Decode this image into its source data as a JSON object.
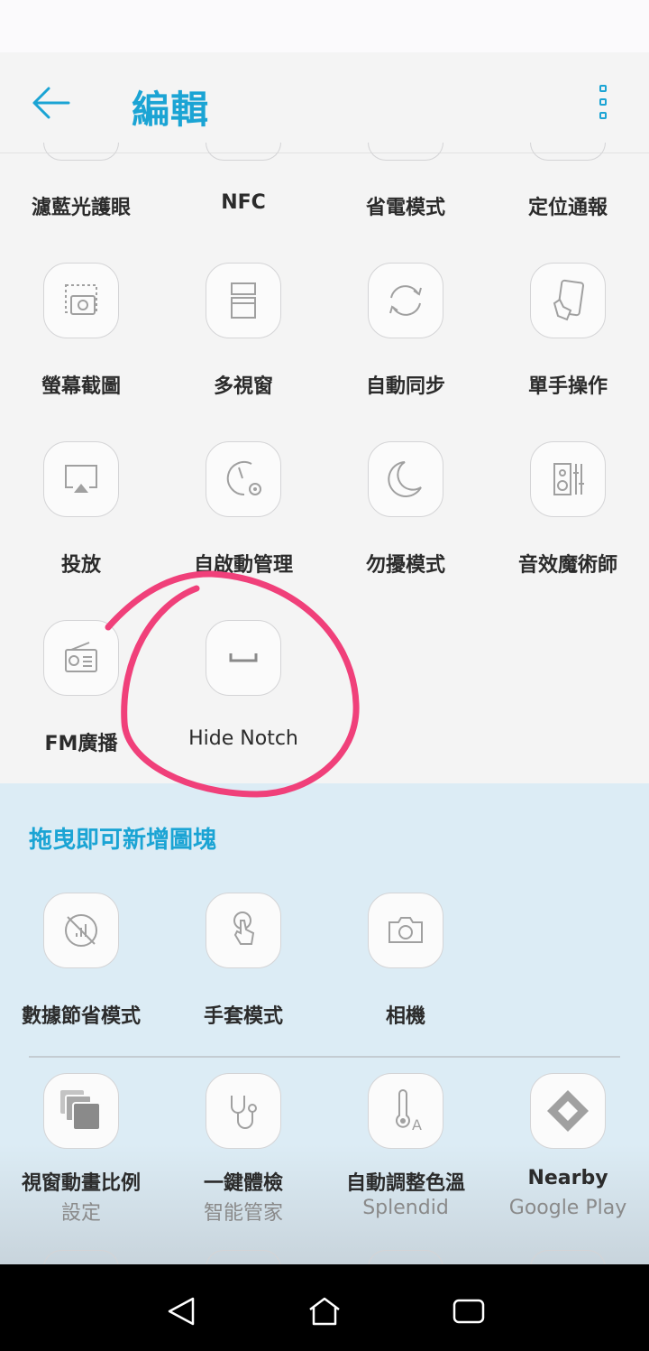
{
  "header": {
    "title": "編輯"
  },
  "active_tiles": [
    {
      "label": "濾藍光護眼",
      "icon": "bluelight-icon"
    },
    {
      "label": "NFC",
      "icon": "nfc-icon"
    },
    {
      "label": "省電模式",
      "icon": "battery-saver-icon"
    },
    {
      "label": "定位通報",
      "icon": "location-icon"
    },
    {
      "label": "螢幕截圖",
      "icon": "screenshot-icon"
    },
    {
      "label": "多視窗",
      "icon": "multi-window-icon"
    },
    {
      "label": "自動同步",
      "icon": "sync-icon"
    },
    {
      "label": "單手操作",
      "icon": "one-hand-icon"
    },
    {
      "label": "投放",
      "icon": "cast-icon"
    },
    {
      "label": "自啟動管理",
      "icon": "autostart-icon"
    },
    {
      "label": "勿擾模式",
      "icon": "moon-icon"
    },
    {
      "label": "音效魔術師",
      "icon": "audio-wizard-icon"
    },
    {
      "label": "FM廣播",
      "icon": "radio-icon"
    },
    {
      "label": "Hide Notch",
      "icon": "hide-notch-icon"
    }
  ],
  "drawer": {
    "title": "拖曳即可新增圖塊",
    "tiles": [
      {
        "label": "數據節省模式",
        "icon": "data-saver-icon"
      },
      {
        "label": "手套模式",
        "icon": "glove-icon"
      },
      {
        "label": "相機",
        "icon": "camera-icon"
      }
    ],
    "app_tiles": [
      {
        "label": "視窗動畫比例",
        "sub": "設定",
        "icon": "window-animation-icon"
      },
      {
        "label": "一鍵體檢",
        "sub": "智能管家",
        "icon": "stethoscope-icon"
      },
      {
        "label": "自動調整色溫",
        "sub": "Splendid",
        "icon": "thermometer-icon"
      },
      {
        "label": "Nearby",
        "sub": "Google Play",
        "icon": "nearby-icon"
      }
    ]
  },
  "colors": {
    "accent": "#1ba4d4",
    "annotation": "#f0407a",
    "drawer_bg": "#dcecf5"
  }
}
